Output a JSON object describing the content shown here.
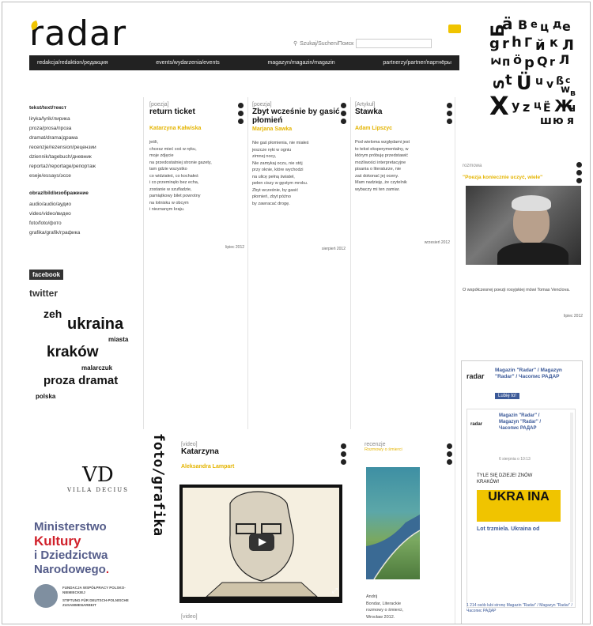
{
  "header": {
    "logo": "radar",
    "search_placeholder": "Szukaj/Suchen/Поиск",
    "nav": [
      "redakcja/redaktion/редакция",
      "events/wydarzenia/events",
      "magazyn/magazin/magazin",
      "partnerzy/partner/партнёры"
    ]
  },
  "menu": {
    "h1": "tekst/text/текст",
    "items1": [
      "liryka/lyrik/лирика",
      "proza/prosa/проза",
      "dramat/drama/драма",
      "recenzje/rezension/рецензии",
      "dziennik/tagebuch/дневник",
      "reportaż/reportage/репортаж",
      "eseje/essays/эссе"
    ],
    "h2": "obraz/bild/изображение",
    "items2": [
      "audio/audio/аудио",
      "video/video/видео",
      "foto/foto/фото",
      "grafika/grafik/графика"
    ]
  },
  "social": {
    "facebook": "facebook",
    "twitter": "twitter"
  },
  "tags": [
    {
      "text": "zeh",
      "size": 14
    },
    {
      "text": "ukraina",
      "size": 20
    },
    {
      "text": "miasta",
      "size": 8
    },
    {
      "text": "kraków",
      "size": 19
    },
    {
      "text": "malarczuk",
      "size": 8
    },
    {
      "text": "proza dramat",
      "size": 15
    },
    {
      "text": "polska",
      "size": 8
    }
  ],
  "articles": [
    {
      "section": "[poezja]",
      "title": "return ticket",
      "author": "Katarzyna Kałwiska",
      "body": [
        "jeśli,",
        "chcesz mieć coś w ręku,",
        "moje zdjęcie",
        "na przedostatniej stronie gazety,",
        "tam gdzie wszystko",
        "co widziałeś, co kochałeś",
        "i co przeminęło bez echa,",
        "zostanie w szufladzie,",
        "pamiątkowy bilet powrotny",
        "na lotnisku w obcym",
        "i nieznanym kraju."
      ],
      "meta": [
        "lipiec 2012"
      ]
    },
    {
      "section": "[poezja]",
      "title": "Zbyt wcześnie by gasić płomień",
      "author": "Marjana Sawka",
      "body": [
        "Nie gaś płomienia, nie miałeś",
        "jeszcze ręki w ogniu",
        "zimnej nocy,",
        "Nie zamykaj oczu, nie stój",
        "przy oknie, które wychodzi",
        "na ulicę pełną świateł,",
        "pełen ciszy w gęstym mroku.",
        "",
        "Zbyt wcześnie, by gasić",
        "płomień, zbyt późno",
        "by zawracać drogę."
      ],
      "meta": [
        "sierpień 2012"
      ]
    },
    {
      "section": "[Artykuł]",
      "title": "Stawka",
      "author": "Adam Lipszyc",
      "body": [
        "Pod wieloma względami jest",
        "to tekst eksperymentalny, w",
        "którym próbuję przedstawić",
        "możliwości interpretacyjne",
        "pisania o literaturze, nie",
        "zaś dokonać jej oceny.",
        "Mam nadzieję, że czytelnik",
        "wybaczy mi ten zamiar."
      ],
      "meta": [
        "wrzesień 2012"
      ]
    }
  ],
  "side": {
    "section": "rozmowa",
    "headline": "\"Poezja koniecznie uczyć, wiele\"",
    "caption": "O współczesnej poezji rosyjskiej mówi Tomas Venclova.",
    "meta": "lipiec 2012"
  },
  "foto": {
    "label": "foto/grafika",
    "section": "[video]",
    "title": "Katarzyna",
    "author": "Aleksandra Lampart",
    "section2": "[video]"
  },
  "recenzje": {
    "section": "recenzje",
    "headline": "Rozmowy o śmierci",
    "body": [
      "Andrij",
      "Bondar, Literackie",
      "rozmowy o śmierci,",
      "Wrocław 2012."
    ]
  },
  "ad": {
    "title1": "Magazin \"Radar\" / Magazyn \"Radar\" / Часопис РАДАР",
    "like": "Lubię to!",
    "title2": "Magazin \"Radar\" / Magazyn \"Radar\" / Часопис РАДАР",
    "date": "6 sierpnia o 10:13",
    "note": "TYLE SIĘ DZIEJE! ZNÓW KRAKÓW!",
    "banner": "UKRA INA",
    "caption": "Lot trzmiela. Ukraina od",
    "fans": "1 214 osób lubi stronę Magazin \"Radar\" / Magazyn \"Radar\" / Часопис РАДАР"
  },
  "partners": {
    "vd_top": "VD",
    "vd_name": "VILLA DECIUS",
    "m1": "Ministerstwo",
    "m2": "Kultury",
    "m3": "i Dziedzictwa",
    "m4": "Narodowego",
    "fund1": "FUNDACJA WSPÓŁPRACY POLSKO-NIEMIECKIEJ",
    "fund2": "STIFTUNG FÜR DEUTSCH-POLNISCHE ZUSAMMENARBEIT"
  },
  "colors": {
    "accent": "#f0c400",
    "dark": "#222222",
    "red": "#d0202a",
    "ministry_blue": "#555d8a"
  }
}
